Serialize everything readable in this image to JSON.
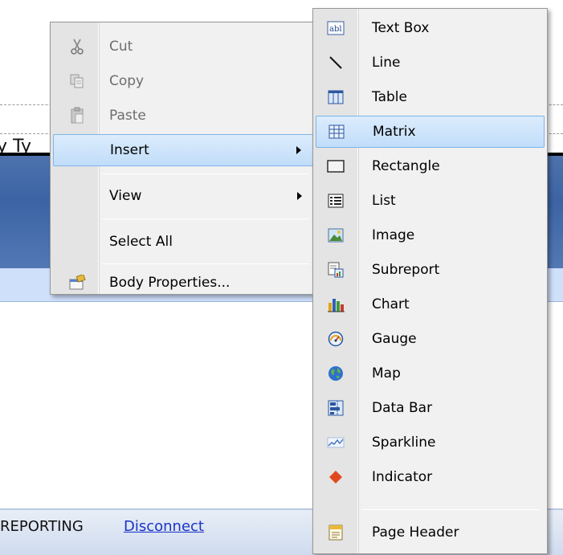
{
  "background": {
    "partial_text": "y Ty",
    "status": {
      "prefix": "REPORTING",
      "link": "Disconnect"
    }
  },
  "context_menu": {
    "items": [
      {
        "label": "Cut",
        "icon": "scissors-icon",
        "enabled": false
      },
      {
        "label": "Copy",
        "icon": "copy-icon",
        "enabled": false
      },
      {
        "label": "Paste",
        "icon": "paste-icon",
        "enabled": false
      },
      {
        "label": "Insert",
        "has_submenu": true,
        "highlighted": true
      },
      {
        "label": "View",
        "has_submenu": true
      },
      {
        "label": "Select All"
      },
      {
        "label": "Body Properties...",
        "icon": "properties-icon"
      }
    ]
  },
  "insert_submenu": {
    "items": [
      {
        "label": "Text Box",
        "icon": "textbox-icon"
      },
      {
        "label": "Line",
        "icon": "line-icon"
      },
      {
        "label": "Table",
        "icon": "table-icon"
      },
      {
        "label": "Matrix",
        "icon": "matrix-icon",
        "highlighted": true
      },
      {
        "label": "Rectangle",
        "icon": "rectangle-icon"
      },
      {
        "label": "List",
        "icon": "list-icon"
      },
      {
        "label": "Image",
        "icon": "image-icon"
      },
      {
        "label": "Subreport",
        "icon": "subreport-icon"
      },
      {
        "label": "Chart",
        "icon": "chart-icon"
      },
      {
        "label": "Gauge",
        "icon": "gauge-icon"
      },
      {
        "label": "Map",
        "icon": "map-icon"
      },
      {
        "label": "Data Bar",
        "icon": "data-bar-icon"
      },
      {
        "label": "Sparkline",
        "icon": "sparkline-icon"
      },
      {
        "label": "Indicator",
        "icon": "indicator-icon"
      },
      {
        "label": "Page Header",
        "icon": "page-header-icon"
      }
    ]
  },
  "colors": {
    "menu_bg": "#f1f1f1",
    "highlight_bg": "#c1ddfa",
    "highlight_border": "#7eb4ea",
    "band_dark": "#3c64a4",
    "band_light": "#cfe0fb",
    "link": "#1a33c9"
  }
}
